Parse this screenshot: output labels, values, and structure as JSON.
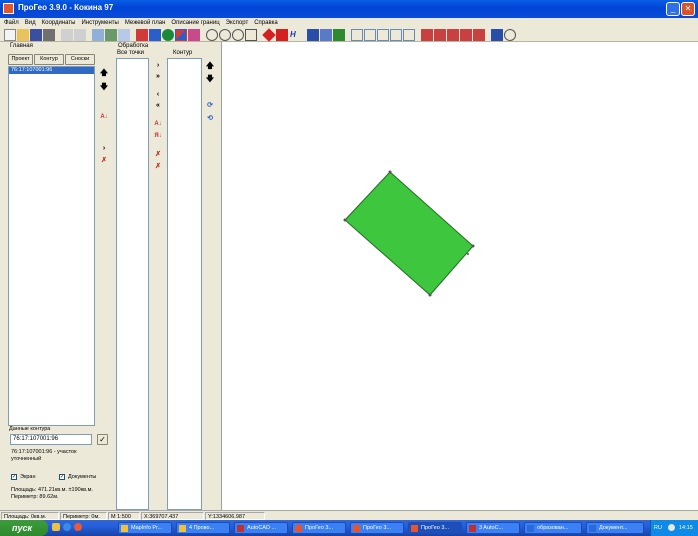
{
  "title": "ПроГео 3.9.0 - Кокина 97",
  "menu": [
    "Файл",
    "Вид",
    "Координаты",
    "Инструменты",
    "Межевой план",
    "Описание границ",
    "Экспорт",
    "Справка"
  ],
  "left_panel": {
    "header": "Главная",
    "tabs": [
      "Проект",
      "Контур",
      "Сноски"
    ],
    "list_items": [
      "76:17:107001:96"
    ],
    "contour_group": "Данные контура",
    "contour_id": "76:17:107001:96",
    "contour_desc": "76:17:107001:96 - участок уточненный",
    "checkbox_screen": "Экран",
    "checkbox_docs": "Документы",
    "area_text": "Площадь: 471.21кв.м. ±190кв.м.",
    "perimeter_text": "Периметр: 89.62м."
  },
  "processing_panel": {
    "header": "Обработка",
    "all_points": "Все точки",
    "contour": "Контур"
  },
  "status": {
    "area": "Площадь: 0кв.м.",
    "perimeter": "Периметр: 0м.",
    "scale": "M 1:500",
    "x": "X:369707.437",
    "y": "Y:1334606.987"
  },
  "taskbar": {
    "start": "пуск",
    "tasks": [
      "MapInfo Pr...",
      "4 Прово...",
      "AutoCAD ...",
      "ПроГео 3...",
      "ПроГео 3...",
      "ПроГео 3...",
      "3 AutoC...",
      "образован...",
      "Документ..."
    ],
    "lang": "RU",
    "clock": "14:15"
  },
  "colors": {
    "parcel_fill": "#3fc63f",
    "parcel_stroke": "#1e6e1e",
    "title_bar": "#0a5ee4",
    "selection": "#316ac5"
  }
}
